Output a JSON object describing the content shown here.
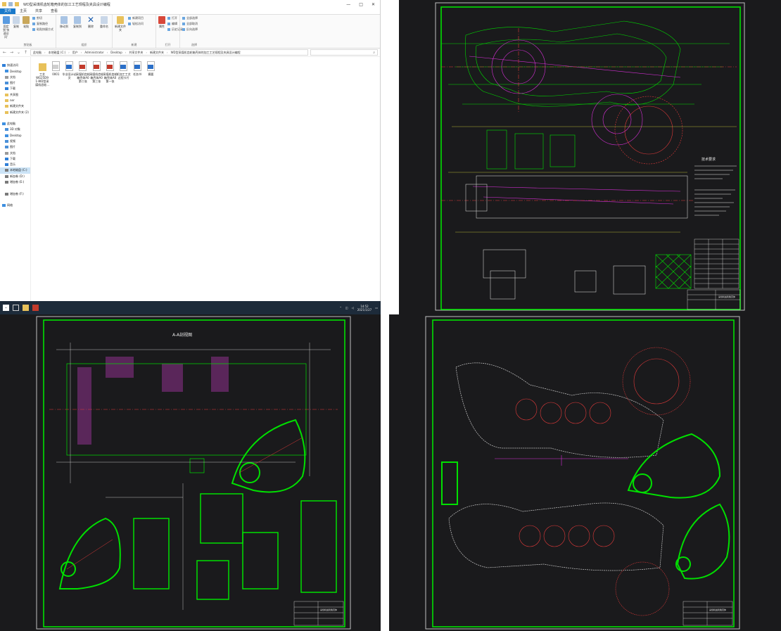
{
  "explorer": {
    "title": "WD型采煤机齿轮箱壳体的加工工艺规程及夹具设计编程",
    "window_controls": [
      "—",
      "□",
      "✕"
    ],
    "tabs": [
      "文件",
      "主页",
      "共享",
      "查看"
    ],
    "ribbon": {
      "groups": [
        {
          "name": "剪贴板",
          "buttons": [
            "固定到'快速访问'",
            "复制",
            "粘贴"
          ],
          "small": [
            "复制路径",
            "粘贴快捷方式"
          ],
          "extra": [
            "剪切"
          ]
        },
        {
          "name": "组织",
          "buttons": [
            "移动到",
            "复制到",
            "删除",
            "重命名"
          ]
        },
        {
          "name": "新建",
          "buttons": [
            "新建文件夹"
          ],
          "small": [
            "新建项目",
            "轻松访问"
          ]
        },
        {
          "name": "打开",
          "buttons": [
            "属性"
          ],
          "small": [
            "打开",
            "编辑",
            "历史记录"
          ]
        },
        {
          "name": "选择",
          "small": [
            "全部选择",
            "全部取消",
            "反向选择"
          ]
        }
      ]
    },
    "address": {
      "parts": [
        "此电脑",
        "本地磁盘 (C:)",
        "用户",
        "Administrator",
        "Desktop",
        "共享文件夹",
        "新建文件夹",
        "WD型采煤机齿轮箱壳体的加工工艺规程及夹具设计编程"
      ],
      "search_placeholder": "⌕"
    },
    "nav": [
      {
        "label": "快速访问",
        "indent": false,
        "icon": "star-icon",
        "color": "#2f7fd8"
      },
      {
        "label": "Desktop",
        "indent": true,
        "icon": "desktop-icon",
        "color": "#3d8fe0"
      },
      {
        "label": "文档",
        "indent": true,
        "icon": "document-icon",
        "color": "#9a9a9a"
      },
      {
        "label": "图片",
        "indent": true,
        "icon": "picture-icon",
        "color": "#4a90d8"
      },
      {
        "label": "下载",
        "indent": true,
        "icon": "download-icon",
        "color": "#2f7fd8"
      },
      {
        "label": "共享图",
        "indent": true,
        "icon": "folder-icon",
        "color": "#e8c15a"
      },
      {
        "label": "ner",
        "indent": true,
        "icon": "folder-icon",
        "color": "#e8c15a"
      },
      {
        "label": "新建文件夹",
        "indent": true,
        "icon": "folder-icon",
        "color": "#e8c15a"
      },
      {
        "label": "新建文件夹 (2)",
        "indent": true,
        "icon": "folder-icon",
        "color": "#e8c15a"
      },
      {
        "label": "",
        "indent": false,
        "icon": "",
        "color": ""
      },
      {
        "label": "此电脑",
        "indent": false,
        "icon": "computer-icon",
        "color": "#3d8fe0"
      },
      {
        "label": "3D 对象",
        "indent": true,
        "icon": "cube-icon",
        "color": "#4a90d8"
      },
      {
        "label": "Desktop",
        "indent": true,
        "icon": "desktop-icon",
        "color": "#3d8fe0"
      },
      {
        "label": "视频",
        "indent": true,
        "icon": "video-icon",
        "color": "#4a90d8"
      },
      {
        "label": "图片",
        "indent": true,
        "icon": "picture-icon",
        "color": "#4a90d8"
      },
      {
        "label": "文档",
        "indent": true,
        "icon": "document-icon",
        "color": "#9a9a9a"
      },
      {
        "label": "下载",
        "indent": true,
        "icon": "download-icon",
        "color": "#2f7fd8"
      },
      {
        "label": "音乐",
        "indent": true,
        "icon": "music-icon",
        "color": "#2f7fd8"
      },
      {
        "label": "本地磁盘 (C:)",
        "indent": true,
        "icon": "drive-icon",
        "color": "#7a7a7a",
        "selected": true
      },
      {
        "label": "新加卷 (D:)",
        "indent": true,
        "icon": "drive-icon",
        "color": "#7a7a7a"
      },
      {
        "label": "增加卷 (E:)",
        "indent": true,
        "icon": "drive-icon",
        "color": "#7a7a7a"
      },
      {
        "label": "",
        "indent": false,
        "icon": "",
        "color": ""
      },
      {
        "label": "增加卷 (F:)",
        "indent": true,
        "icon": "drive-icon",
        "color": "#7a7a7a"
      },
      {
        "label": "",
        "indent": false,
        "icon": "",
        "color": ""
      },
      {
        "label": "网络",
        "indent": false,
        "icon": "network-icon",
        "color": "#3d8fe0"
      }
    ],
    "files": [
      {
        "name": "工艺\nWG25D9\n1-WD型采\n煤机齿轮...",
        "type": "folder",
        "color": "#e8c15a"
      },
      {
        "name": "0001",
        "type": "doc",
        "color": "#cfcfcf"
      },
      {
        "name": "毕业设计论\n文",
        "type": "word",
        "color": "#2b6fc8"
      },
      {
        "name": "采煤机齿轮\n箱壳体A0\n第二张",
        "type": "cad",
        "color": "#c23a2b"
      },
      {
        "name": "采煤机齿轮\n箱壳体A0\n第三张",
        "type": "cad",
        "color": "#c23a2b"
      },
      {
        "name": "采煤机齿轮\n箱壳体A0\n第一张",
        "type": "cad",
        "color": "#c23a2b"
      },
      {
        "name": "机加工工艺\n过程卡片",
        "type": "word",
        "color": "#2b6fc8"
      },
      {
        "name": "任务书",
        "type": "word",
        "color": "#2b6fc8"
      },
      {
        "name": "摘要",
        "type": "word",
        "color": "#2b6fc8"
      }
    ],
    "status": "9 个项目",
    "taskbar": {
      "time": "14:52",
      "date": "2021/1/27"
    }
  },
  "cad_panels": [
    {
      "id": "top-right",
      "notes_title": "技术要求",
      "title_block_label": "采煤机齿轮箱壳体"
    },
    {
      "id": "bottom-left",
      "view_title": "A-A剖视图",
      "title_block_label": "采煤机齿轮箱壳体"
    },
    {
      "id": "bottom-right",
      "title_block_label": "采煤机齿轮箱壳体"
    }
  ],
  "colors": {
    "cad_background": "#1a1a1c",
    "frame_green": "#00e000",
    "line_magenta": "#d830d8",
    "line_red": "#e03a3a",
    "line_white": "#e8e8e8",
    "line_yellow": "#d8d840",
    "line_cyan": "#38d8d8",
    "accent_blue": "#1979ca"
  }
}
